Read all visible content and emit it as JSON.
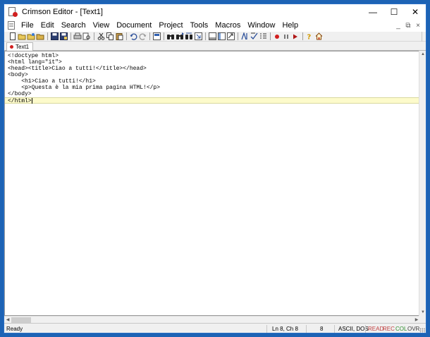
{
  "window": {
    "title": "Crimson Editor - [Text1]",
    "controls": {
      "minimize": "—",
      "maximize": "☐",
      "close": "✕"
    }
  },
  "menu": {
    "items": [
      "File",
      "Edit",
      "Search",
      "View",
      "Document",
      "Project",
      "Tools",
      "Macros",
      "Window",
      "Help"
    ],
    "mdi_controls": {
      "minimize": "_",
      "restore": "⧉",
      "close": "×"
    }
  },
  "toolbar": {
    "buttons": [
      "new-icon",
      "open-icon",
      "open-remote-icon",
      "save-all-icon",
      "save-icon",
      "save-as-icon",
      "print-icon",
      "print-preview-icon",
      "cut-icon",
      "copy-icon",
      "paste-icon",
      "undo-icon",
      "redo-icon",
      "spell-icon",
      "find-icon",
      "find-next-icon",
      "replace-icon",
      "goto-icon",
      "toggle-output-icon",
      "directory-icon",
      "word-wrap-icon",
      "columns-icon",
      "line-numbers-icon",
      "record-macro-icon",
      "pause-macro-icon",
      "play-macro-icon",
      "help-icon",
      "home-icon"
    ]
  },
  "tabs": [
    {
      "label": "Text1",
      "active": true
    }
  ],
  "editor": {
    "lines": [
      "<!doctype html>",
      "<html lang=\"it\">",
      "<head><title>Ciao a tutti!</title></head>",
      "<body>",
      "    <h1>Ciao a tutti!</h1>",
      "    <p>Questa è la mia prima pagina HTML!</p>",
      "</body>",
      "</html>"
    ],
    "current_line": 8
  },
  "statusbar": {
    "state": "Ready",
    "position": "Ln 8, Ch 8",
    "col_value": "8",
    "encoding": "ASCII, DOS",
    "flags": [
      "READ",
      "REC",
      "COL",
      "OVR"
    ],
    "colors": {
      "READ": "#c04040",
      "REC": "#c04040",
      "COL": "#2f8f2f",
      "OVR": "#404040"
    }
  }
}
